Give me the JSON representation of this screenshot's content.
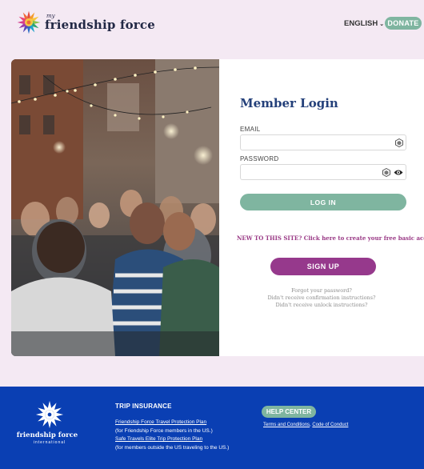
{
  "header": {
    "logo_my": "my",
    "logo_name": "friendship force",
    "language": "ENGLISH",
    "donate_label": "DONATE"
  },
  "login": {
    "title": "Member Login",
    "email_label": "EMAIL",
    "email_value": "",
    "password_label": "PASSWORD",
    "password_value": "",
    "login_label": "LOG IN",
    "new_site_text": "NEW TO THIS SITE? Click here to create your free basic account!",
    "signup_label": "SIGN UP",
    "links": [
      "Forgot your password?",
      "Didn't receive confirmation instructions?",
      "Didn't receive unlock instructions?"
    ]
  },
  "footer": {
    "logo_name": "friendship force",
    "logo_sub": "international",
    "trip_title": "TRIP INSURANCE",
    "trip_link_1": "Friendship Force Travel Protection Plan",
    "trip_note_1": "(for Friendship Force members in the US.)",
    "trip_link_2": "Safe Travels Elite Trip Protection Plan",
    "trip_note_2": "(for members outside the US traveling to the US.)",
    "help_center_label": "HELP CENTER",
    "terms_label": "Terms and Conditions",
    "separator": ", ",
    "conduct_label": "Code of Conduct"
  },
  "colors": {
    "page_bg": "#f4e9f3",
    "accent_green": "#7fb5a0",
    "accent_purple": "#96398c",
    "title_blue": "#24407a",
    "footer_blue": "#0a3fb3"
  }
}
